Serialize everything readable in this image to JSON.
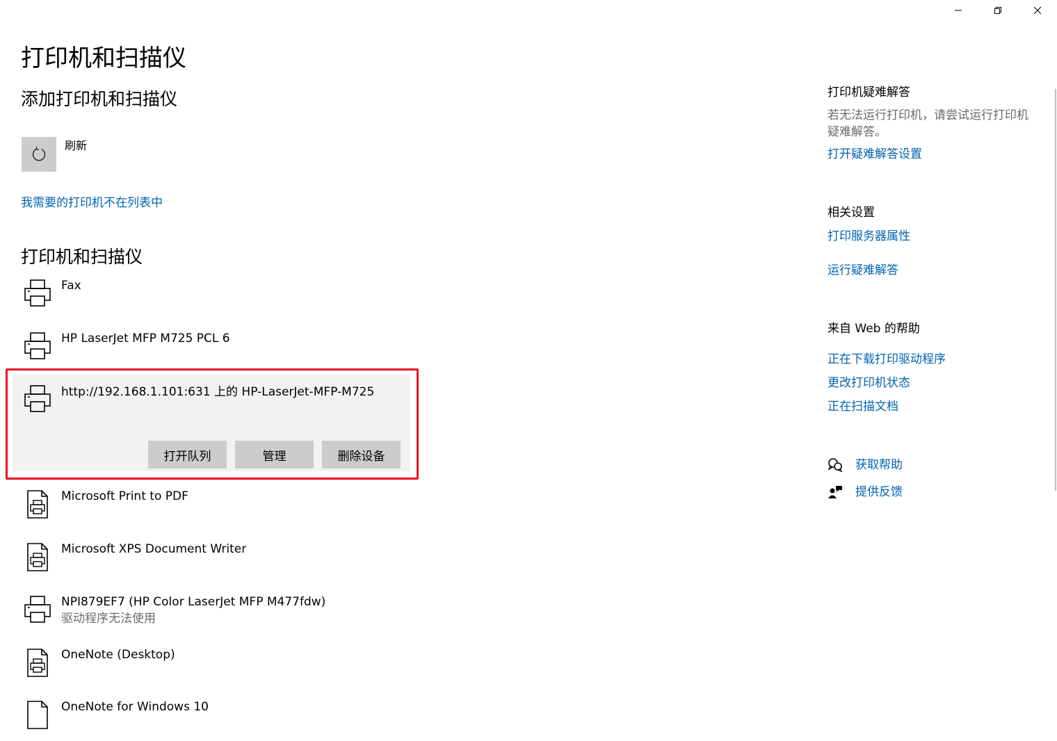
{
  "window": {
    "controls": [
      "minimize-icon",
      "restore-icon",
      "close-icon"
    ]
  },
  "page": {
    "title": "打印机和扫描仪"
  },
  "add_section": {
    "title": "添加打印机和扫描仪",
    "refresh_label": "刷新",
    "missing_printer_link": "我需要的打印机不在列表中"
  },
  "devices_section": {
    "title": "打印机和扫描仪",
    "devices": [
      {
        "name": "Fax",
        "icon": "printer-icon"
      },
      {
        "name": "HP LaserJet MFP M725 PCL 6",
        "icon": "printer-icon"
      },
      {
        "name": "http://192.168.1.101:631 上的 HP-LaserJet-MFP-M725",
        "icon": "printer-icon",
        "selected": true,
        "actions": [
          "打开队列",
          "管理",
          "删除设备"
        ]
      },
      {
        "name": "Microsoft Print to PDF",
        "icon": "document-printer-icon"
      },
      {
        "name": "Microsoft XPS Document Writer",
        "icon": "document-printer-icon"
      },
      {
        "name": "NPI879EF7 (HP Color LaserJet MFP M477fdw)",
        "status": "驱动程序无法使用",
        "icon": "printer-icon"
      },
      {
        "name": "OneNote (Desktop)",
        "icon": "document-printer-icon"
      },
      {
        "name": "OneNote for Windows 10",
        "icon": "document-printer-icon"
      }
    ]
  },
  "sidebar": {
    "troubleshoot": {
      "heading": "打印机疑难解答",
      "text": "若无法运行打印机，请尝试运行打印机疑难解答。",
      "link": "打开疑难解答设置"
    },
    "related": {
      "heading": "相关设置",
      "links": [
        "打印服务器属性",
        "运行疑难解答"
      ]
    },
    "web_help": {
      "heading": "来自 Web 的帮助",
      "links": [
        "正在下载打印驱动程序",
        "更改打印机状态",
        "正在扫描文档"
      ]
    },
    "support": {
      "get_help": "获取帮助",
      "feedback": "提供反馈"
    }
  },
  "colors": {
    "link": "#0063b1",
    "highlight": "#e81123",
    "selected_bg": "#f2f2f2",
    "button_bg": "#cccccc"
  }
}
